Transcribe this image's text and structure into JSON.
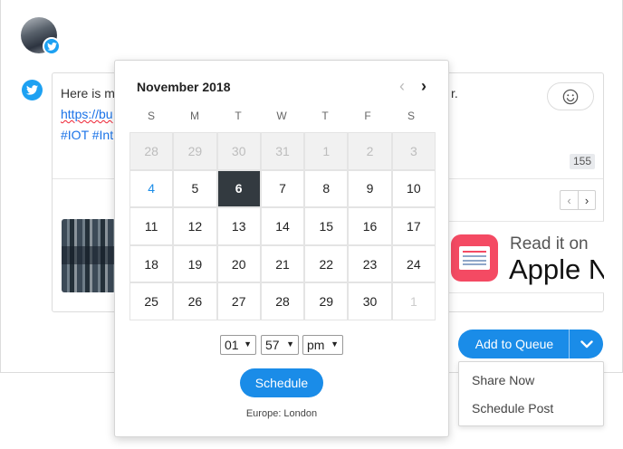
{
  "composer": {
    "line1_start": "Here is m",
    "line1_end": "r.",
    "line2": "https://bu",
    "line3": "#IOT #Int",
    "char_count": "155",
    "preview_text_small": "Read it on",
    "preview_text_big": "Apple N"
  },
  "queue": {
    "add_label": "Add to Queue",
    "menu": [
      "Share Now",
      "Schedule Post"
    ]
  },
  "calendar": {
    "month_title": "November 2018",
    "weekdays": [
      "S",
      "M",
      "T",
      "W",
      "T",
      "F",
      "S"
    ],
    "weeks": [
      [
        "28",
        "29",
        "30",
        "31",
        "1",
        "2",
        "3"
      ],
      [
        "4",
        "5",
        "6",
        "7",
        "8",
        "9",
        "10"
      ],
      [
        "11",
        "12",
        "13",
        "14",
        "15",
        "16",
        "17"
      ],
      [
        "18",
        "19",
        "20",
        "21",
        "22",
        "23",
        "24"
      ],
      [
        "25",
        "26",
        "27",
        "28",
        "29",
        "30",
        "1"
      ]
    ],
    "today": "4",
    "selected": "6",
    "hour": "01",
    "minute": "57",
    "ampm": "pm",
    "schedule_label": "Schedule",
    "timezone": "Europe: London"
  },
  "colors": {
    "accent": "#1a8ce8",
    "twitter": "#1da1f2",
    "selected_day": "#333a40"
  },
  "icons": [
    "twitter-icon",
    "emoji-icon",
    "chevron-left-icon",
    "chevron-right-icon",
    "chevron-down-icon"
  ]
}
